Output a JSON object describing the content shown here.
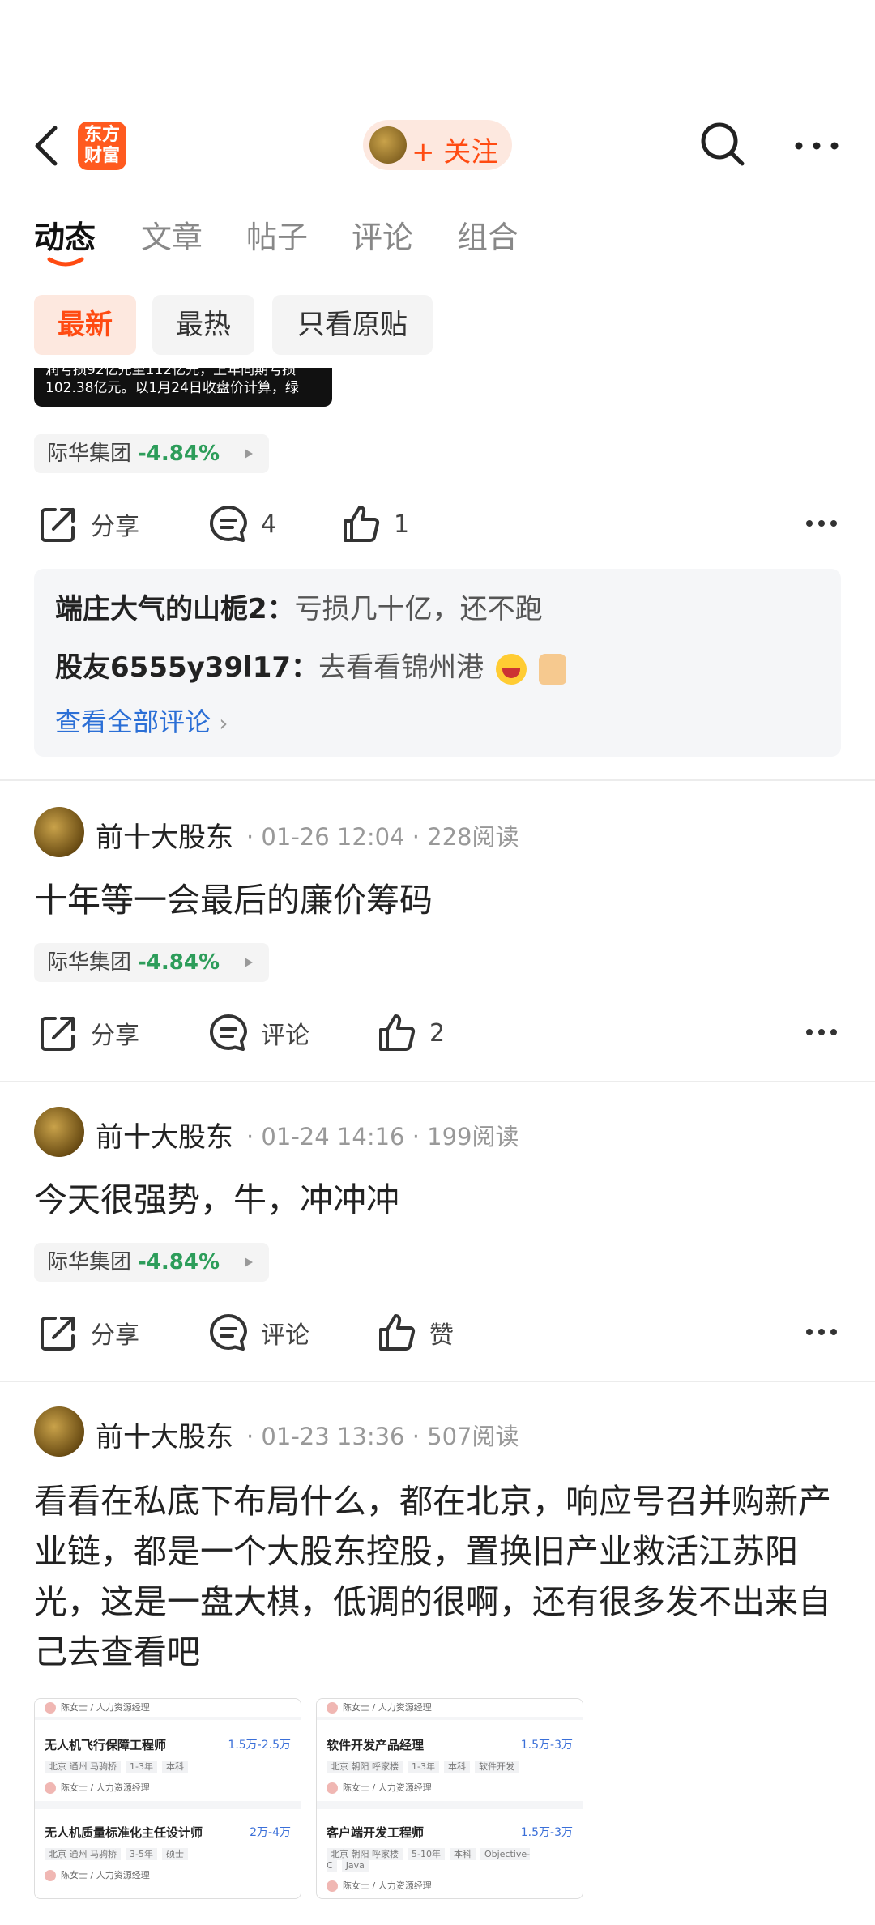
{
  "header": {
    "logo_text": "东方\n财富",
    "follow_label": "+ 关注"
  },
  "tabs": [
    {
      "label": "动态"
    },
    {
      "label": "文章"
    },
    {
      "label": "帖子"
    },
    {
      "label": "评论"
    },
    {
      "label": "组合"
    }
  ],
  "filters": [
    {
      "label": "最新"
    },
    {
      "label": "最热"
    },
    {
      "label": "只看原贴"
    }
  ],
  "image_remnant": {
    "line1": "润亏损92亿元至112亿元，上年同期亏损",
    "line2": "102.38亿元。以1月24日收盘价计算，绿"
  },
  "stock": {
    "name": "际华集团",
    "change": "-4.84%"
  },
  "first_post_actions": {
    "share": "分享",
    "comments": "4",
    "likes": "1"
  },
  "comments": [
    {
      "user": "端庄大气的山栀2：",
      "text": "亏损几十亿，还不跑"
    },
    {
      "user": "股友6555y39l17：",
      "text": "去看看锦州港"
    }
  ],
  "see_all": "查看全部评论",
  "posts": [
    {
      "user": "前十大股东",
      "meta": "· 01-26 12:04 · 228阅读",
      "text": "十年等一会最后的廉价筹码",
      "share": "分享",
      "comment": "评论",
      "like": "2"
    },
    {
      "user": "前十大股东",
      "meta": "· 01-24 14:16 · 199阅读",
      "text": "今天很强势，牛，冲冲冲",
      "share": "分享",
      "comment": "评论",
      "like": "赞"
    },
    {
      "user": "前十大股东",
      "meta": "· 01-23 13:36 · 507阅读",
      "text": "看看在私底下布局什么，都在北京，响应号召并购新产业链，都是一个大股东控股，置换旧产业救活江苏阳光，这是一盘大棋，低调的很啊，还有很多发不出来自己去查看吧"
    }
  ],
  "job_images": {
    "left": {
      "hr_top": "陈女士 / 人力资源经理",
      "job1_title": "无人机飞行保障工程师",
      "job1_salary": "1.5万-2.5万",
      "job1_tags": [
        "北京 通州 马驹桥",
        "1-3年",
        "本科"
      ],
      "hr1": "陈女士 / 人力资源经理",
      "job2_title": "无人机质量标准化主任设计师",
      "job2_salary": "2万-4万",
      "job2_tags": [
        "北京 通州 马驹桥",
        "3-5年",
        "硕士"
      ],
      "hr2": "陈女士 / 人力资源经理"
    },
    "right": {
      "hr_top": "陈女士 / 人力资源经理",
      "job1_title": "软件开发产品经理",
      "job1_salary": "1.5万-3万",
      "job1_tags": [
        "北京 朝阳 呼家楼",
        "1-3年",
        "本科",
        "软件开发"
      ],
      "hr1": "陈女士 / 人力资源经理",
      "job2_title": "客户端开发工程师",
      "job2_salary": "1.5万-3万",
      "job2_tags": [
        "北京 朝阳 呼家楼",
        "5-10年",
        "本科",
        "Objective-C",
        "Java"
      ],
      "hr2": "陈女士 / 人力资源经理"
    }
  },
  "colors": {
    "accent": "#ff4b12",
    "stock_down": "#2d9d5a",
    "link": "#2b6fd6"
  }
}
